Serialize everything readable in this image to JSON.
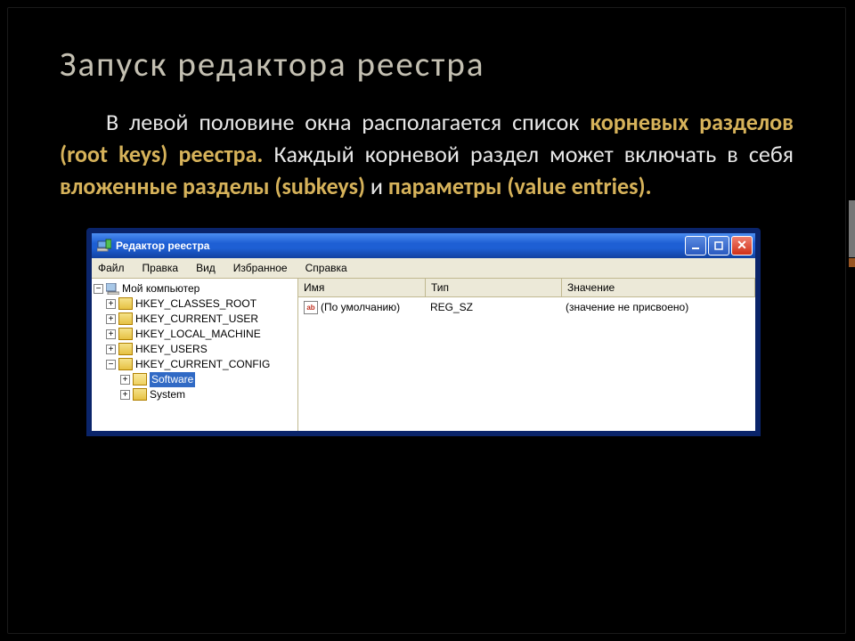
{
  "title": "Запуск редактора реестра",
  "para": {
    "t1": "В левой половине окна располагается список ",
    "h1": "корневых разделов (root keys) реестра.",
    "t2": " Каждый корневой раздел может включать в себя ",
    "h2": "вложенные разделы (subkeys)",
    "t3": " и ",
    "h3": "параметры (value entries)."
  },
  "win": {
    "title": "Редактор реестра",
    "menu": [
      "Файл",
      "Правка",
      "Вид",
      "Избранное",
      "Справка"
    ],
    "tree": {
      "root": "Мой компьютер",
      "keys": [
        "HKEY_CLASSES_ROOT",
        "HKEY_CURRENT_USER",
        "HKEY_LOCAL_MACHINE",
        "HKEY_USERS",
        "HKEY_CURRENT_CONFIG"
      ],
      "sub": [
        "Software",
        "System"
      ]
    },
    "cols": {
      "name": "Имя",
      "type": "Тип",
      "value": "Значение"
    },
    "row": {
      "name": "(По умолчанию)",
      "type": "REG_SZ",
      "value": "(значение не присвоено)"
    }
  }
}
